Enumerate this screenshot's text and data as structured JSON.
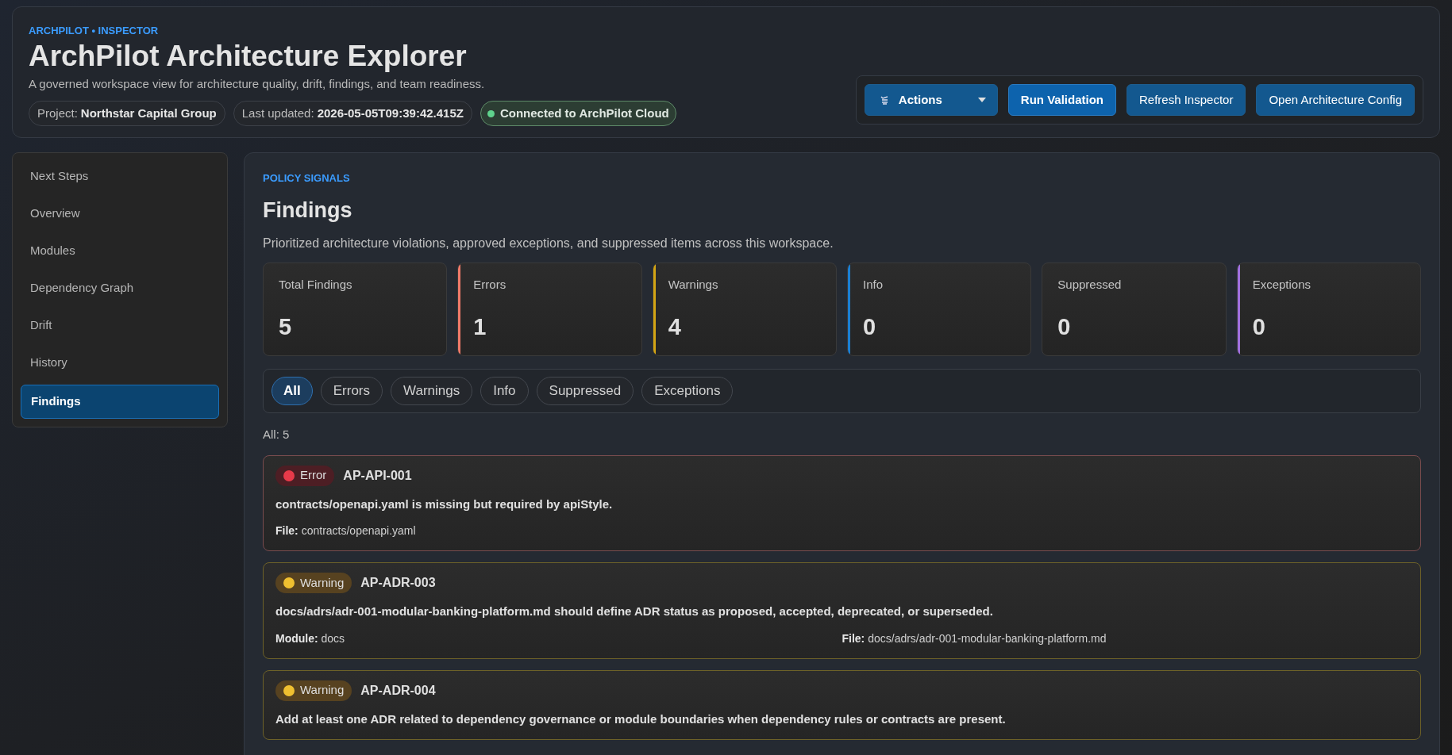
{
  "header": {
    "eyebrow": "ARCHPILOT • INSPECTOR",
    "title": "ArchPilot Architecture Explorer",
    "subtitle": "A governed workspace view for architecture quality, drift, findings, and team readiness.",
    "chips": [
      {
        "kind": "meta",
        "label": "Project:",
        "value": "Northstar Capital Group"
      },
      {
        "kind": "meta",
        "label": "Last updated:",
        "value": "2026-05-05T09:39:42.415Z"
      },
      {
        "kind": "status",
        "label": "Connected to ArchPilot Cloud",
        "color": "#5fd38d"
      }
    ]
  },
  "actions": [
    {
      "kind": "menu",
      "label": "Actions"
    },
    {
      "kind": "primary",
      "label": "Run Validation"
    },
    {
      "kind": "secondary",
      "label": "Refresh Inspector"
    },
    {
      "kind": "secondary",
      "label": "Open Architecture Config"
    }
  ],
  "sidebar": {
    "items": [
      {
        "label": "Next Steps",
        "selected": false
      },
      {
        "label": "Overview",
        "selected": false
      },
      {
        "label": "Modules",
        "selected": false
      },
      {
        "label": "Dependency Graph",
        "selected": false
      },
      {
        "label": "Drift",
        "selected": false
      },
      {
        "label": "History",
        "selected": false
      },
      {
        "label": "Findings",
        "selected": true
      }
    ]
  },
  "main": {
    "eyebrow": "POLICY SIGNALS",
    "title": "Findings",
    "description": "Prioritized architecture violations, approved exceptions, and suppressed items across this workspace.",
    "stats": [
      {
        "label": "Total Findings",
        "value": "5"
      },
      {
        "label": "Errors",
        "value": "1",
        "color": "#f07a6a"
      },
      {
        "label": "Warnings",
        "value": "4",
        "color": "#d4a514"
      },
      {
        "label": "Info",
        "value": "0",
        "color": "#1a7fd4"
      },
      {
        "label": "Suppressed",
        "value": "0"
      },
      {
        "label": "Exceptions",
        "value": "0",
        "color": "#a070e0"
      }
    ],
    "filters": [
      {
        "label": "All",
        "selected": true
      },
      {
        "label": "Errors",
        "selected": false
      },
      {
        "label": "Warnings",
        "selected": false
      },
      {
        "label": "Info",
        "selected": false
      },
      {
        "label": "Suppressed",
        "selected": false
      },
      {
        "label": "Exceptions",
        "selected": false
      }
    ],
    "count": "All: 5",
    "findings": [
      {
        "kind": "error",
        "badge": "Error",
        "code": "AP-API-001",
        "message": "contracts/openapi.yaml is missing but required by apiStyle.",
        "fields": [
          {
            "label": "File:",
            "value": "contracts/openapi.yaml"
          }
        ]
      },
      {
        "kind": "warning",
        "badge": "Warning",
        "code": "AP-ADR-003",
        "message": "docs/adrs/adr-001-modular-banking-platform.md should define ADR status as proposed, accepted, deprecated, or superseded.",
        "fields": [
          {
            "label": "Module:",
            "value": "docs"
          },
          {
            "label": "File:",
            "value": "docs/adrs/adr-001-modular-banking-platform.md"
          }
        ]
      },
      {
        "kind": "warning",
        "badge": "Warning",
        "code": "AP-ADR-004",
        "message": "Add at least one ADR related to dependency governance or module boundaries when dependency rules or contracts are present."
      }
    ]
  }
}
